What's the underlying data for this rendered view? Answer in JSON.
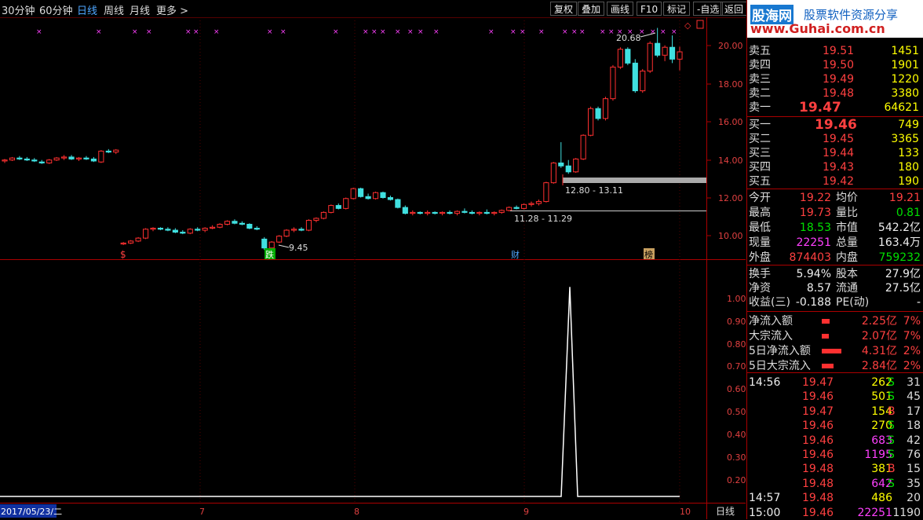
{
  "toolbar": {
    "tabs": [
      "30分钟",
      "60分钟",
      "日线",
      "周线",
      "月线",
      "更多 >"
    ],
    "active_tab": "日线",
    "buttons": [
      "复权",
      "叠加",
      "画线",
      "F10",
      "标记",
      "-自选",
      "返回"
    ]
  },
  "brand": {
    "name": "股海网",
    "slogan": "股票软件资源分享",
    "url": "www.Guhai.com.cn"
  },
  "chart": {
    "price_axis": [
      "20.00",
      "18.00",
      "16.00",
      "14.00",
      "12.00",
      "10.00"
    ],
    "indicator_axis": [
      "1.00",
      "0.90",
      "0.80",
      "0.70",
      "0.60",
      "0.50",
      "0.40",
      "0.30",
      "0.20"
    ],
    "annotations": {
      "high": "20.68",
      "low": "9.45",
      "zone1": "12.80 - 13.11",
      "zone2": "11.28 - 11.29"
    },
    "event_markers": [
      "$",
      "跌",
      "财",
      "榜"
    ],
    "date_axis": {
      "start": "2017/05/23/二",
      "months": [
        "7",
        "8",
        "9",
        "10"
      ]
    },
    "period_label": "日线"
  },
  "chart_data": {
    "type": "candlestick",
    "ylim": [
      9.3,
      20.9
    ],
    "candles": [
      [
        13.95,
        14.05,
        13.85,
        14.0
      ],
      [
        14.0,
        14.15,
        13.95,
        14.1
      ],
      [
        14.1,
        14.2,
        14.0,
        14.05
      ],
      [
        14.05,
        14.15,
        13.95,
        14.0
      ],
      [
        14.0,
        14.1,
        13.9,
        13.95
      ],
      [
        13.9,
        14.0,
        13.8,
        13.85
      ],
      [
        13.85,
        14.05,
        13.8,
        14.0
      ],
      [
        14.0,
        14.15,
        13.95,
        14.1
      ],
      [
        14.1,
        14.25,
        14.0,
        14.15
      ],
      [
        14.15,
        14.25,
        14.0,
        14.05
      ],
      [
        14.05,
        14.15,
        13.95,
        14.1
      ],
      [
        14.1,
        14.2,
        14.0,
        14.05
      ],
      [
        14.05,
        14.15,
        13.9,
        13.95
      ],
      [
        13.9,
        14.5,
        13.85,
        14.45
      ],
      [
        14.45,
        14.55,
        14.35,
        14.4
      ],
      [
        14.4,
        14.55,
        14.3,
        14.5
      ],
      [
        9.75,
        9.85,
        9.7,
        9.8
      ],
      [
        9.8,
        9.95,
        9.75,
        9.9
      ],
      [
        9.9,
        10.1,
        9.85,
        10.05
      ],
      [
        10.05,
        10.55,
        10.0,
        10.5
      ],
      [
        10.5,
        10.6,
        10.4,
        10.55
      ],
      [
        10.55,
        10.6,
        10.45,
        10.5
      ],
      [
        10.5,
        10.6,
        10.4,
        10.45
      ],
      [
        10.45,
        10.55,
        10.3,
        10.35
      ],
      [
        10.35,
        10.45,
        10.25,
        10.3
      ],
      [
        10.3,
        10.55,
        10.25,
        10.5
      ],
      [
        10.5,
        10.6,
        10.4,
        10.45
      ],
      [
        10.45,
        10.6,
        10.35,
        10.55
      ],
      [
        10.55,
        10.7,
        10.5,
        10.6
      ],
      [
        10.6,
        10.8,
        10.55,
        10.75
      ],
      [
        10.75,
        10.95,
        10.7,
        10.9
      ],
      [
        10.9,
        11.0,
        10.75,
        10.8
      ],
      [
        10.8,
        10.9,
        10.7,
        10.75
      ],
      [
        10.75,
        10.8,
        10.5,
        10.55
      ],
      [
        10.55,
        10.65,
        10.45,
        10.5
      ],
      [
        10.0,
        10.1,
        9.45,
        9.55
      ],
      [
        9.55,
        9.9,
        9.5,
        9.85
      ],
      [
        9.85,
        10.2,
        9.8,
        10.15
      ],
      [
        10.15,
        10.5,
        10.1,
        10.45
      ],
      [
        10.45,
        10.6,
        10.35,
        10.5
      ],
      [
        10.5,
        10.6,
        10.4,
        10.45
      ],
      [
        10.45,
        11.0,
        10.4,
        10.95
      ],
      [
        10.95,
        11.1,
        10.85,
        11.05
      ],
      [
        11.05,
        11.4,
        11.0,
        11.35
      ],
      [
        11.35,
        11.75,
        11.3,
        11.7
      ],
      [
        11.7,
        11.8,
        11.5,
        11.55
      ],
      [
        11.55,
        12.1,
        11.5,
        12.05
      ],
      [
        12.05,
        12.6,
        12.0,
        12.55
      ],
      [
        12.55,
        12.6,
        12.1,
        12.15
      ],
      [
        12.15,
        12.3,
        12.0,
        12.05
      ],
      [
        12.05,
        12.4,
        12.0,
        12.35
      ],
      [
        12.35,
        12.4,
        12.05,
        12.1
      ],
      [
        12.1,
        12.2,
        11.95,
        12.0
      ],
      [
        12.0,
        12.05,
        11.55,
        11.6
      ],
      [
        11.6,
        11.7,
        11.25,
        11.3
      ],
      [
        11.3,
        11.45,
        11.2,
        11.35
      ],
      [
        11.35,
        11.4,
        11.25,
        11.3
      ],
      [
        11.3,
        11.45,
        11.2,
        11.35
      ],
      [
        11.35,
        11.4,
        11.25,
        11.3
      ],
      [
        11.3,
        11.4,
        11.2,
        11.35
      ],
      [
        11.35,
        11.45,
        11.25,
        11.3
      ],
      [
        11.3,
        11.45,
        11.2,
        11.4
      ],
      [
        11.4,
        11.55,
        11.3,
        11.35
      ],
      [
        11.35,
        11.45,
        11.25,
        11.3
      ],
      [
        11.3,
        11.4,
        11.2,
        11.35
      ],
      [
        11.35,
        11.5,
        11.25,
        11.3
      ],
      [
        11.3,
        11.4,
        11.2,
        11.35
      ],
      [
        11.35,
        11.5,
        11.28,
        11.45
      ],
      [
        11.45,
        11.65,
        11.4,
        11.6
      ],
      [
        11.6,
        11.7,
        11.5,
        11.55
      ],
      [
        11.55,
        11.8,
        11.5,
        11.75
      ],
      [
        11.75,
        11.9,
        11.65,
        11.8
      ],
      [
        11.8,
        12.0,
        11.7,
        11.9
      ],
      [
        11.9,
        12.9,
        11.85,
        12.85
      ],
      [
        12.85,
        13.9,
        12.8,
        13.85
      ],
      [
        13.85,
        14.9,
        13.6,
        13.7
      ],
      [
        13.7,
        14.0,
        13.3,
        13.4
      ],
      [
        13.4,
        14.1,
        13.35,
        14.05
      ],
      [
        14.05,
        15.3,
        14.0,
        15.25
      ],
      [
        15.25,
        16.7,
        15.2,
        16.6
      ],
      [
        16.6,
        16.7,
        16.0,
        16.1
      ],
      [
        16.1,
        17.2,
        16.0,
        17.1
      ],
      [
        17.1,
        18.8,
        17.0,
        18.7
      ],
      [
        18.7,
        19.7,
        18.6,
        19.6
      ],
      [
        19.6,
        19.7,
        18.8,
        18.9
      ],
      [
        18.9,
        19.1,
        17.4,
        17.5
      ],
      [
        17.5,
        18.6,
        17.4,
        18.5
      ],
      [
        18.5,
        20.0,
        18.4,
        19.9
      ],
      [
        19.9,
        20.68,
        19.2,
        19.3
      ],
      [
        19.3,
        19.8,
        19.0,
        19.7
      ],
      [
        19.7,
        20.3,
        18.9,
        19.1
      ],
      [
        19.1,
        19.73,
        18.53,
        19.47
      ]
    ],
    "indicator": {
      "ylim": [
        0,
        1.05
      ],
      "spike_value": 1.0
    }
  },
  "quote": {
    "asks": [
      {
        "label": "卖五",
        "price": "19.51",
        "vol": "1451"
      },
      {
        "label": "卖四",
        "price": "19.50",
        "vol": "1901"
      },
      {
        "label": "卖三",
        "price": "19.49",
        "vol": "1220"
      },
      {
        "label": "卖二",
        "price": "19.48",
        "vol": "3380"
      },
      {
        "label": "卖一",
        "price": "19.47",
        "vol": "64621"
      }
    ],
    "bids": [
      {
        "label": "买一",
        "price": "19.46",
        "vol": "749"
      },
      {
        "label": "买二",
        "price": "19.45",
        "vol": "3365"
      },
      {
        "label": "买三",
        "price": "19.44",
        "vol": "133"
      },
      {
        "label": "买四",
        "price": "19.43",
        "vol": "180"
      },
      {
        "label": "买五",
        "price": "19.42",
        "vol": "190"
      }
    ],
    "stats": [
      {
        "l1": "今开",
        "v1": "19.22",
        "c1": "red",
        "l2": "均价",
        "v2": "19.21",
        "c2": "red"
      },
      {
        "l1": "最高",
        "v1": "19.73",
        "c1": "red",
        "l2": "量比",
        "v2": "0.81",
        "c2": "green"
      },
      {
        "l1": "最低",
        "v1": "18.53",
        "c1": "green",
        "l2": "市值",
        "v2": "542.2亿",
        "c2": "white"
      },
      {
        "l1": "现量",
        "v1": "22251",
        "c1": "magenta",
        "l2": "总量",
        "v2": "163.4万",
        "c2": "white"
      },
      {
        "l1": "外盘",
        "v1": "874403",
        "c1": "red",
        "l2": "内盘",
        "v2": "759232",
        "c2": "green"
      }
    ],
    "fin": [
      {
        "l1": "换手",
        "v1": "5.94%",
        "l2": "股本",
        "v2": "27.9亿"
      },
      {
        "l1": "净资",
        "v1": "8.57",
        "l2": "流通",
        "v2": "27.5亿"
      },
      {
        "l1": "收益(三)",
        "v1": "-0.188",
        "l2": "PE(动)",
        "v2": "-"
      }
    ],
    "flows": [
      {
        "label": "净流入额",
        "value": "2.25亿",
        "pct": "7%",
        "bar": 0.35
      },
      {
        "label": "大宗流入",
        "value": "2.07亿",
        "pct": "7%",
        "bar": 0.32
      },
      {
        "label": "5日净流入额",
        "value": "4.31亿",
        "pct": "2%",
        "bar": 0.9
      },
      {
        "label": "5日大宗流入",
        "value": "2.84亿",
        "pct": "2%",
        "bar": 0.55
      }
    ],
    "ticks": [
      {
        "time": "14:56",
        "price": "19.47",
        "vol": "262",
        "vc": "yellow",
        "side": "S",
        "n": "31"
      },
      {
        "time": "",
        "price": "19.46",
        "vol": "501",
        "vc": "yellow",
        "side": "S",
        "n": "45"
      },
      {
        "time": "",
        "price": "19.47",
        "vol": "154",
        "vc": "yellow",
        "side": "B",
        "n": "17"
      },
      {
        "time": "",
        "price": "19.46",
        "vol": "270",
        "vc": "yellow",
        "side": "S",
        "n": "18"
      },
      {
        "time": "",
        "price": "19.46",
        "vol": "683",
        "vc": "magenta",
        "side": "S",
        "n": "42"
      },
      {
        "time": "",
        "price": "19.46",
        "vol": "1195",
        "vc": "magenta",
        "side": "S",
        "n": "76"
      },
      {
        "time": "",
        "price": "19.48",
        "vol": "381",
        "vc": "yellow",
        "side": "B",
        "n": "15"
      },
      {
        "time": "",
        "price": "19.48",
        "vol": "642",
        "vc": "magenta",
        "side": "S",
        "n": "35"
      },
      {
        "time": "14:57",
        "price": "19.48",
        "vol": "486",
        "vc": "yellow",
        "side": "",
        "n": "20"
      },
      {
        "time": "15:00",
        "price": "19.46",
        "vol": "22251",
        "vc": "magenta",
        "side": "",
        "n": "1190"
      }
    ]
  }
}
